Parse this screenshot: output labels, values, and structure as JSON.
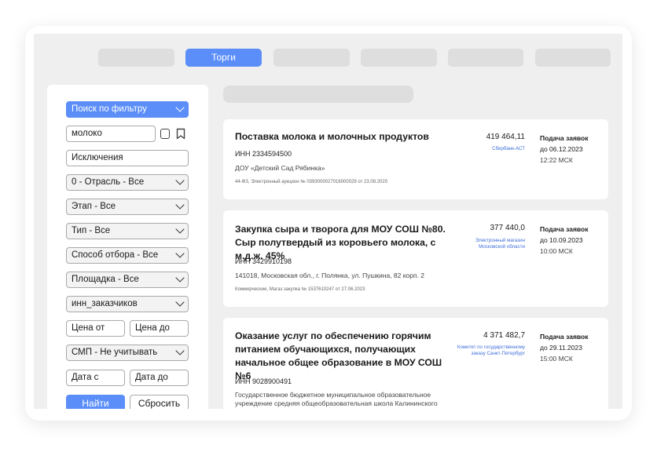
{
  "tabs": [
    {
      "label": ""
    },
    {
      "label": "Торги"
    },
    {
      "label": ""
    },
    {
      "label": ""
    },
    {
      "label": ""
    },
    {
      "label": ""
    }
  ],
  "filters": {
    "mode": "Поиск по фильтру",
    "query": "молоко",
    "exclusions": "Исключения",
    "industry": "0 - Отрасль - Все",
    "stage": "Этап - Все",
    "type": "Тип - Все",
    "selection_method": "Способ отбора - Все",
    "platform": "Площадка - Все",
    "customer_inn": "инн_заказчиков",
    "price_from": "Цена от",
    "price_to": "Цена до",
    "smp": "СМП - Не учитывать",
    "date_from": "Дата с",
    "date_to": "Дата до",
    "find": "Найти",
    "reset": "Сбросить"
  },
  "results": [
    {
      "title": "Поставка молока и молочных продуктов",
      "inn": "ИНН 2334594500",
      "org": "ДОУ «Детский Сад Рябинка»",
      "meta": "44-ФЗ, Электронный аукцион № 0393000027016000029 от 23.09.2020",
      "price": "419 464,11",
      "platform": "Сбербанк-АСТ",
      "deadline_label": "Подача заявок",
      "deadline_date": "до 06.12.2023",
      "deadline_time": "12:22 МСК"
    },
    {
      "title": "Закупка сыра и творога для МОУ СОШ №80. Сыр полутвердый из коровьего молока, с м.д.ж. 45%",
      "inn": "ИНН 3429910198",
      "org": "141018, Московская обл., г. Полянка, ул. Пушкина, 82 корп. 2",
      "meta": "Коммерческие, Магаз закупка № 1537610247 от 27.06.2023",
      "price": "377 440,0",
      "platform": "Электронный магазин Московской области",
      "deadline_label": "Подача заявок",
      "deadline_date": "до 10.09.2023",
      "deadline_time": "10:00 МСК"
    },
    {
      "title": "Оказание услуг по обеспечению горячим питанием обучающихся, получающих начальное общее образование в МОУ СОШ №6",
      "inn": "ИНН 9028900491",
      "org": "Государственное бюджетное муниципальное образовательное учреждение средняя общеобразовательная школа Калининского",
      "meta": "",
      "price": "4 371 482,7",
      "platform": "Комитет по государственному заказу Санкт-Петербург",
      "deadline_label": "Подача заявок",
      "deadline_date": "до 29.11.2023",
      "deadline_time": "15:00 МСК"
    }
  ],
  "colors": {
    "accent": "#5b8ef8",
    "link": "#3f6fd8",
    "background": "#efefef"
  }
}
